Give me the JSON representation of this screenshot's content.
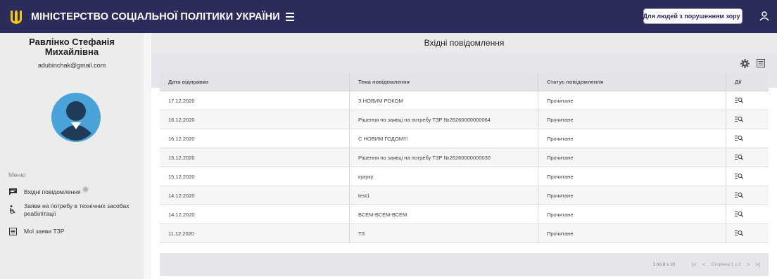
{
  "header": {
    "title": "МІНІСТЕРСТВО СОЦІАЛЬНОЇ ПОЛІТИКИ УКРАЇНИ",
    "vision_button": "Для людей з порушенням зору",
    "bg_color": "#2c2c5c"
  },
  "sidebar": {
    "user_name_line1": "Равлінко Стефанія",
    "user_name_line2": "Михайлівна",
    "email": "adubinchak@gmail.com",
    "menu_label": "Меню",
    "items": [
      {
        "label": "Вхідні повідомлення",
        "icon": "message-icon"
      },
      {
        "label_line1": "Заяви на потребу в технічних засобах",
        "label_line2": "реабілітації",
        "icon": "wheelchair-icon"
      },
      {
        "label": "Мої заяви ТЗР",
        "icon": "list-icon"
      }
    ]
  },
  "main": {
    "title": "Вхідні повідомлення",
    "columns": [
      "Дата відправки",
      "Тема повідомлення",
      "Статус повідомлення",
      "Дії"
    ],
    "rows": [
      {
        "date": "17.12.2020",
        "subject": "З НОВИМ РОКОМ",
        "status": "Прочитане"
      },
      {
        "date": "16.12.2020",
        "subject": "Рішення по заявці на потребу ТЗР №26260000000064",
        "status": "Прочитане"
      },
      {
        "date": "16.12.2020",
        "subject": "С НОВИМ ГОДОМ!!!",
        "status": "Прочитане"
      },
      {
        "date": "15.12.2020",
        "subject": "Рішення по заявці на потребу ТЗР №26260000000030",
        "status": "Прочитане"
      },
      {
        "date": "15.12.2020",
        "subject": "кукуку",
        "status": "Прочитане"
      },
      {
        "date": "14.12.2020",
        "subject": "test1",
        "status": "Прочитане"
      },
      {
        "date": "14.12.2020",
        "subject": "ВСЕМ-ВСЕМ-ВСЕМ",
        "status": "Прочитане"
      },
      {
        "date": "11.12.2020",
        "subject": "ТЗ",
        "status": "Прочитане"
      }
    ],
    "footer": {
      "range": "1 по 8 з 10",
      "page": "Сторінка 1 з 2"
    }
  }
}
